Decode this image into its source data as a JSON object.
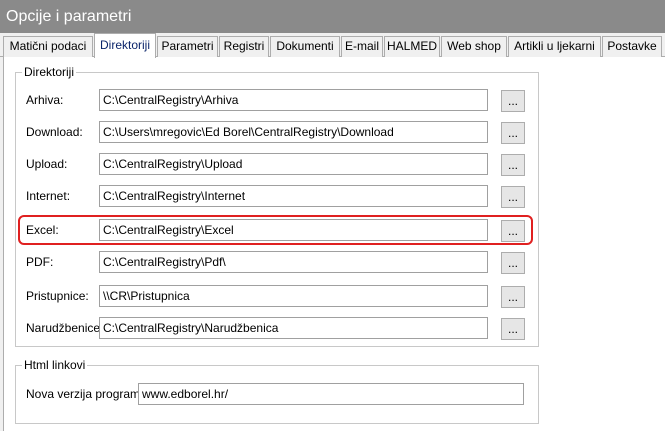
{
  "window": {
    "title": "Opcije i parametri"
  },
  "tabs": [
    {
      "label": "Matični podaci"
    },
    {
      "label": "Direktoriji"
    },
    {
      "label": "Parametri"
    },
    {
      "label": "Registri"
    },
    {
      "label": "Dokumenti"
    },
    {
      "label": "E-mail"
    },
    {
      "label": "HALMED"
    },
    {
      "label": "Web shop"
    },
    {
      "label": "Artikli u ljekarni"
    },
    {
      "label": "Postavke"
    }
  ],
  "active_tab": "Direktoriji",
  "directories": {
    "legend": "Direktoriji",
    "browse_label": "...",
    "rows": [
      {
        "label": "Arhiva:",
        "value": "C:\\CentralRegistry\\Arhiva"
      },
      {
        "label": "Download:",
        "value": "C:\\Users\\mregovic\\Ed Borel\\CentralRegistry\\Download"
      },
      {
        "label": "Upload:",
        "value": "C:\\CentralRegistry\\Upload"
      },
      {
        "label": "Internet:",
        "value": "C:\\CentralRegistry\\Internet"
      },
      {
        "label": "Excel:",
        "value": "C:\\CentralRegistry\\Excel"
      },
      {
        "label": "PDF:",
        "value": "C:\\CentralRegistry\\Pdf\\"
      },
      {
        "label": "Pristupnice:",
        "value": "\\\\CR\\Pristupnica"
      },
      {
        "label": "Narudžbenice:",
        "value": "C:\\CentralRegistry\\Narudžbenica"
      }
    ]
  },
  "html_links": {
    "legend": "Html linkovi",
    "new_version_label": "Nova verzija programa:",
    "new_version_value": "www.edborel.hr/"
  },
  "colors": {
    "title_bar": "#8a8a8a",
    "highlight": "#e02020"
  }
}
